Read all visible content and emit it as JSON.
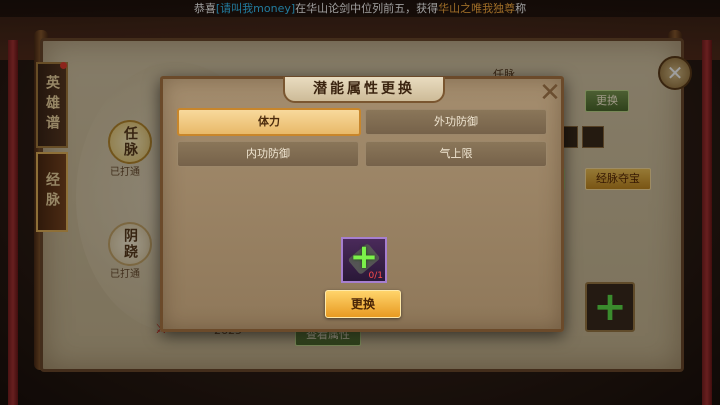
{
  "banner": {
    "prefix": "恭喜",
    "player": "[请叫我money]",
    "middle": "在华山论剑中位列前五，获得",
    "title": "华山之唯我独尊",
    "suffix": "称"
  },
  "side_tabs": [
    "英雄谱",
    "经脉"
  ],
  "meridians": [
    {
      "name": "任脉",
      "status": "已打通"
    },
    {
      "name": "阴跷",
      "status": "已打通"
    }
  ],
  "background": {
    "tab_label": "任脉",
    "change_button": "更换",
    "treasure_button": "经脉夺宝",
    "partial_button": "秀",
    "view_attrs_button": "查看属性",
    "power_value": "2625"
  },
  "modal": {
    "title": "潜能属性更换",
    "options": [
      "体力",
      "外功防御",
      "内功防御",
      "气上限"
    ],
    "selected_option": "体力",
    "item_count": "0/1",
    "confirm_label": "更换"
  },
  "colors": {
    "accent_gold": "#e8b969",
    "highlight_blue": "#37c7ff",
    "highlight_orange": "#ffb040",
    "plus_green": "#7cf24a"
  }
}
